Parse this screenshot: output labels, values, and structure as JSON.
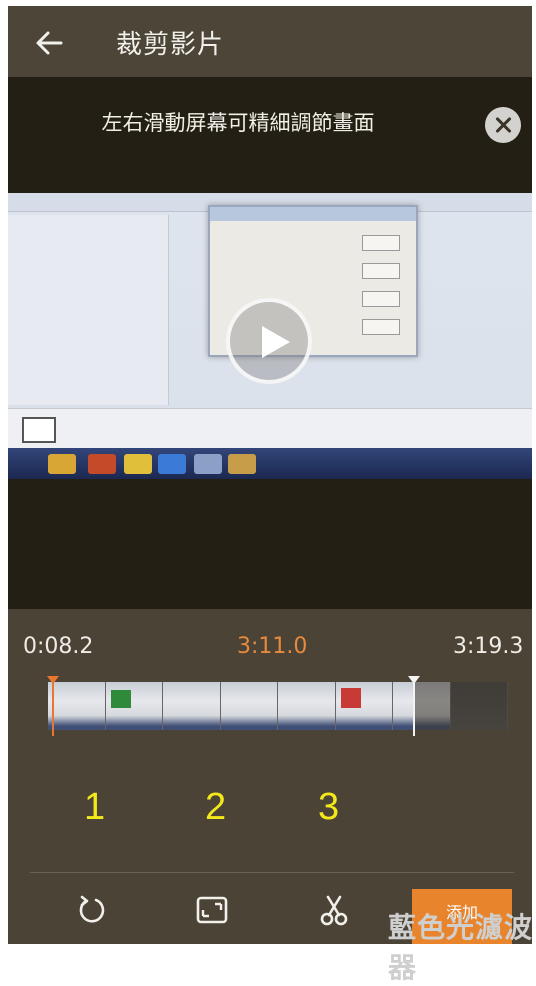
{
  "header": {
    "title": "裁剪影片"
  },
  "video": {
    "hint": "左右滑動屏幕可精細調節畫面"
  },
  "timeline": {
    "start": "0:08.2",
    "current": "3:11.0",
    "end": "3:19.3"
  },
  "annotations": [
    "1",
    "2",
    "3"
  ],
  "toolbar": {
    "add_label": "添加"
  },
  "watermark": "藍色光濾波器",
  "colors": {
    "accent": "#e8842c",
    "background": "#4a4336",
    "annotation": "#f3e91a"
  },
  "icons": [
    "back-arrow-icon",
    "close-icon",
    "play-icon",
    "rotate-icon",
    "crop-ratio-icon",
    "scissors-icon"
  ]
}
